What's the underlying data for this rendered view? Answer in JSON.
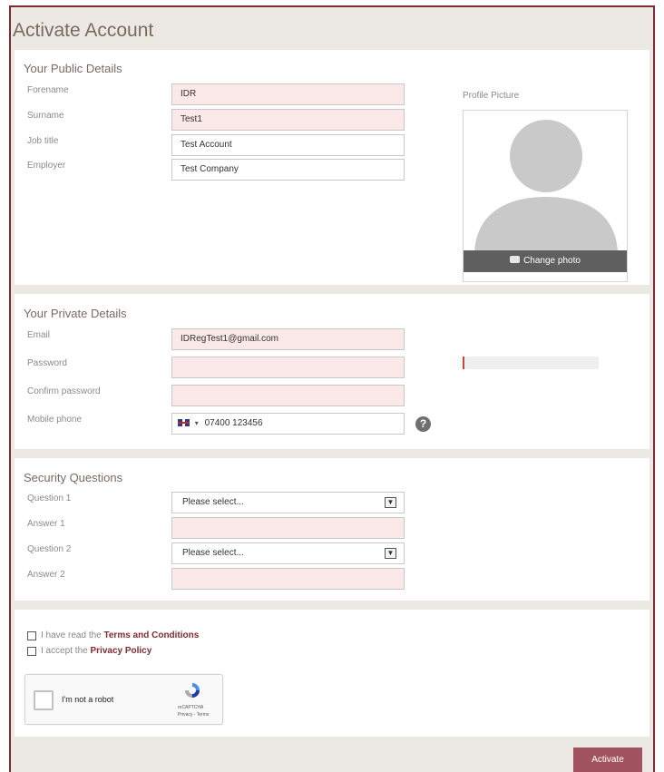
{
  "page": {
    "title": "Activate Account"
  },
  "public_details": {
    "title": "Your Public Details",
    "fields": [
      {
        "label": "Forename",
        "value": "IDR"
      },
      {
        "label": "Surname",
        "value": "Test1"
      },
      {
        "label": "Job title",
        "value": "Test Account"
      },
      {
        "label": "Employer",
        "value": "Test Company"
      }
    ],
    "profile_picture_label": "Profile Picture",
    "change_photo_label": "Change photo"
  },
  "private_details": {
    "title": "Your Private Details",
    "email": {
      "label": "Email",
      "value": "IDRegTest1@gmail.com"
    },
    "password": {
      "label": "Password",
      "value": ""
    },
    "confirm_password": {
      "label": "Confirm password",
      "value": ""
    },
    "mobile": {
      "label": "Mobile phone",
      "value": "07400 123456",
      "help": "?"
    }
  },
  "security": {
    "title": "Security Questions",
    "question1": {
      "label": "Question 1",
      "value": "Please select..."
    },
    "answer1": {
      "label": "Answer 1",
      "value": ""
    },
    "question2": {
      "label": "Question 2",
      "value": "Please select..."
    },
    "answer2": {
      "label": "Answer 2",
      "value": ""
    }
  },
  "agreements": {
    "terms_prefix": "I have read the ",
    "terms_link": "Terms and Conditions",
    "privacy_prefix": "I accept the ",
    "privacy_link": "Privacy Policy"
  },
  "captcha": {
    "label": "I'm not a robot",
    "brand": "reCAPTCHA",
    "links": "Privacy - Terms"
  },
  "footer": {
    "activate_label": "Activate"
  },
  "colors": {
    "accent": "#7d2b35",
    "button": "#a1545f",
    "required_field": "#fbe8e8"
  }
}
